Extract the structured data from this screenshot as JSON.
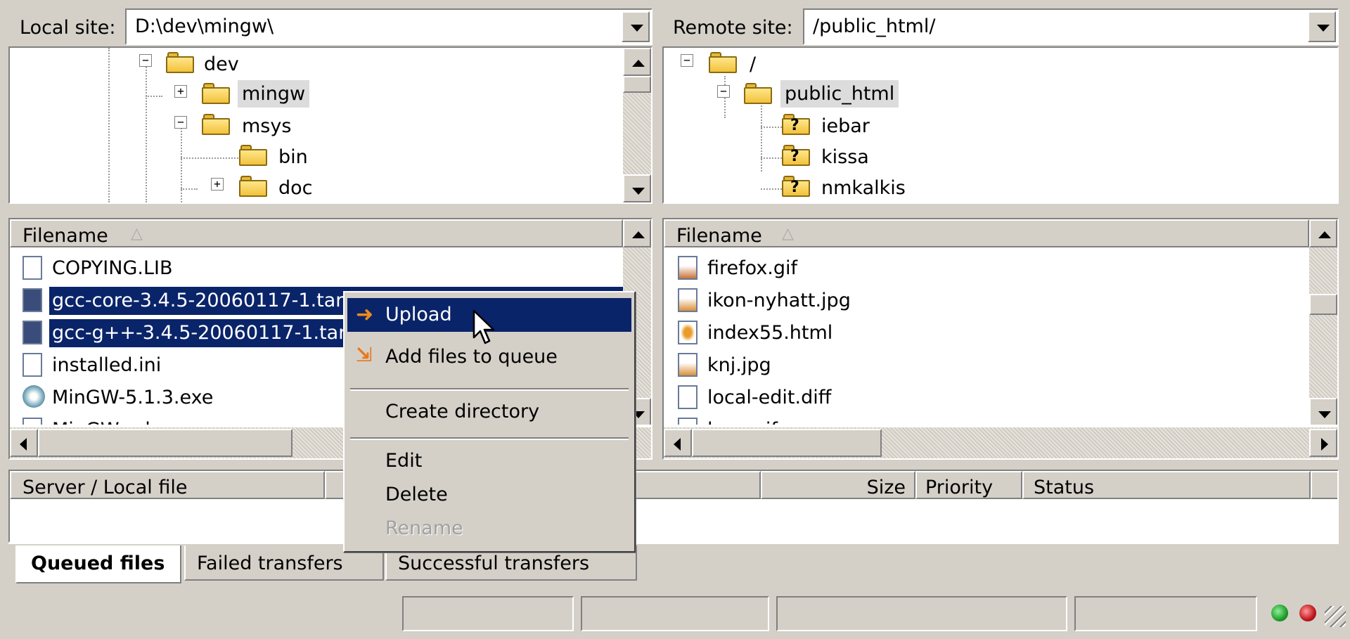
{
  "local": {
    "label": "Local site:",
    "path": "D:\\dev\\mingw\\",
    "tree": [
      {
        "name": "dev",
        "expander": "−"
      },
      {
        "name": "mingw",
        "expander": "+"
      },
      {
        "name": "msys",
        "expander": "−"
      },
      {
        "name": "bin",
        "expander": ""
      },
      {
        "name": "doc",
        "expander": "+"
      }
    ],
    "list_header": "Filename",
    "files": [
      {
        "name": "COPYING.LIB",
        "selected": false
      },
      {
        "name": "gcc-core-3.4.5-20060117-1.tar",
        "selected": true
      },
      {
        "name": "gcc-g++-3.4.5-20060117-1.tar",
        "selected": true
      },
      {
        "name": "installed.ini",
        "selected": false
      },
      {
        "name": "MinGW-5.1.3.exe",
        "selected": false
      },
      {
        "name": "MinGW.cab",
        "selected": false
      }
    ]
  },
  "remote": {
    "label": "Remote site:",
    "path": "/public_html/",
    "tree": [
      {
        "name": "/",
        "expander": "−"
      },
      {
        "name": "public_html",
        "expander": "−"
      },
      {
        "name": "iebar",
        "expander": ""
      },
      {
        "name": "kissa",
        "expander": ""
      },
      {
        "name": "nmkalkis",
        "expander": ""
      }
    ],
    "list_header": "Filename",
    "files": [
      {
        "name": "firefox.gif"
      },
      {
        "name": "ikon-nyhatt.jpg"
      },
      {
        "name": "index55.html"
      },
      {
        "name": "knj.jpg"
      },
      {
        "name": "local-edit.diff"
      },
      {
        "name": "logo.gif"
      }
    ]
  },
  "queue": {
    "columns": [
      "Server / Local file",
      "Size",
      "Priority",
      "Status"
    ],
    "tabs": [
      "Queued files",
      "Failed transfers",
      "Successful transfers"
    ],
    "active_tab": 0
  },
  "context_menu": {
    "items": [
      {
        "label": "Upload",
        "icon": "upload-arrow-icon",
        "highlighted": true,
        "disabled": false
      },
      {
        "label": "Add files to queue",
        "icon": "add-queue-icon",
        "highlighted": false,
        "disabled": false
      },
      {
        "label": "Create directory",
        "icon": "",
        "highlighted": false,
        "disabled": false
      },
      {
        "label": "Edit",
        "icon": "",
        "highlighted": false,
        "disabled": false
      },
      {
        "label": "Delete",
        "icon": "",
        "highlighted": false,
        "disabled": false
      },
      {
        "label": "Rename",
        "icon": "",
        "highlighted": false,
        "disabled": true
      }
    ]
  },
  "colors": {
    "selection": "#0a246a",
    "face": "#d4d0c8",
    "led_green": "#1f9d2a",
    "led_red": "#c0151b"
  }
}
